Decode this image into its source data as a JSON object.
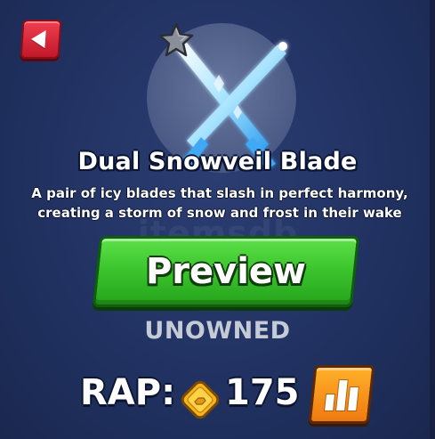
{
  "item": {
    "name": "Dual Snowveil Blade",
    "description": "A pair of icy blades that slash in perfect harmony, creating a storm of snow and frost in their wake",
    "status": "UNOWNED",
    "rap_label": "RAP:",
    "rap_value": "175"
  },
  "buttons": {
    "preview_label": "Preview"
  },
  "watermark": "itemsdb",
  "icons": {
    "back": "back-arrow-icon",
    "star": "star-icon",
    "coin": "coin-icon",
    "chart": "bar-chart-icon"
  },
  "colors": {
    "background": "#213262",
    "preview_button": "#3cc62e",
    "back_button": "#d8202f",
    "chart_button": "#f59418",
    "status_text": "#c5cbd6"
  }
}
